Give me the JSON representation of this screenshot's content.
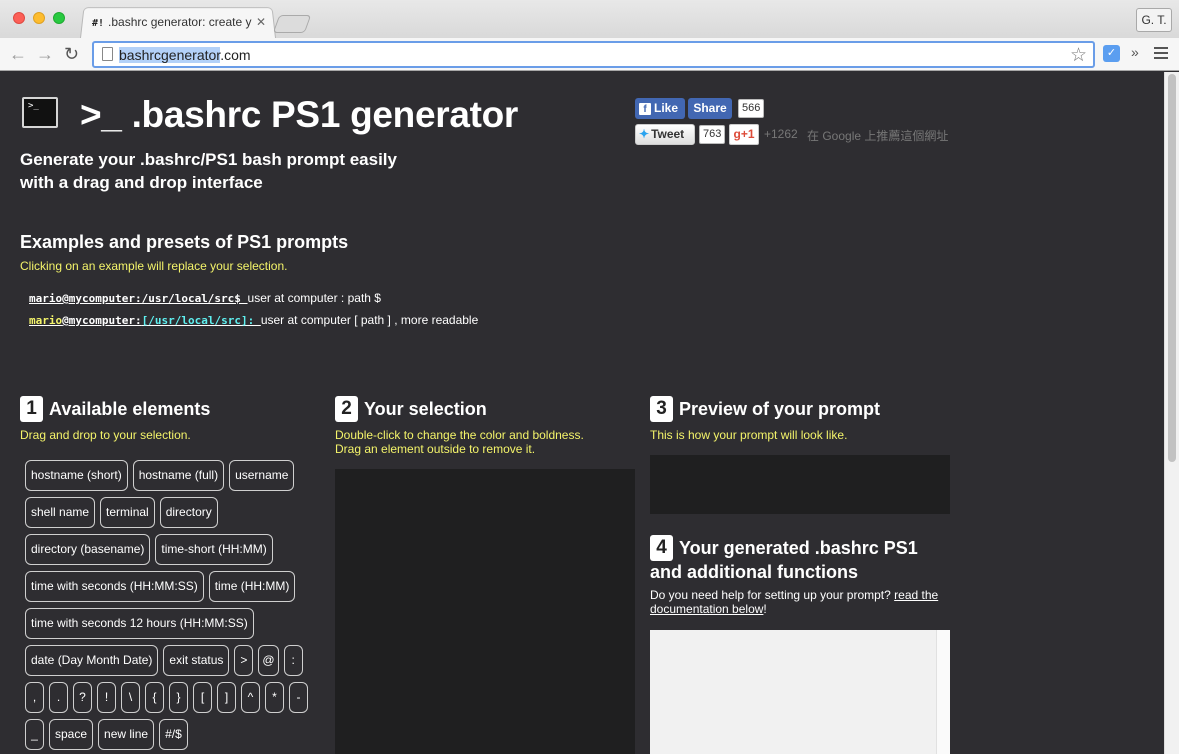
{
  "browser": {
    "tab_title": ".bashrc generator: create y",
    "tab_favicon": "#!",
    "tab_close": "✕",
    "user_button": "G. T.",
    "url_selected": "bashrcgenerator",
    "url_rest": ".com"
  },
  "header": {
    "icon_text": ">_",
    "title": ">_ .bashrc PS1 generator",
    "subtitle_line1": "Generate your .bashrc/PS1 bash prompt easily",
    "subtitle_line2": "with a drag and drop interface"
  },
  "social": {
    "fb_like": "Like",
    "fb_share": "Share",
    "fb_count": "566",
    "tweet": "Tweet",
    "tweet_count": "763",
    "gplus": "g+1",
    "gplus_count": "+1262",
    "gplus_text": "在 Google 上推薦這個網址"
  },
  "examples": {
    "title": "Examples and presets of PS1 prompts",
    "hint": "Clicking on an example will replace your selection.",
    "items": [
      {
        "code": "mario@mycomputer:/usr/local/src$ ",
        "desc": "user at computer : path $"
      },
      {
        "code_user": "mario",
        "code_host": "@mycomputer:",
        "code_path": "[/usr/local/src]: ",
        "desc": "user at computer [ path ] , more readable"
      }
    ]
  },
  "steps": {
    "s1": {
      "num": "1",
      "title": "Available elements",
      "hint": "Drag and drop to your selection."
    },
    "s2": {
      "num": "2",
      "title": "Your selection",
      "hint1": "Double-click to change the color and boldness.",
      "hint2": "Drag an element outside to remove it."
    },
    "s3": {
      "num": "3",
      "title": "Preview of your prompt",
      "hint": "This is how your prompt will look like."
    },
    "s4": {
      "num": "4",
      "title": "Your generated .bashrc PS1",
      "title2": "and additional functions",
      "hint": "Do you need help for setting up your prompt? ",
      "link": "read the documentation below",
      "after": "!"
    }
  },
  "elements": [
    "hostname (short)",
    "hostname (full)",
    "username",
    "shell name",
    "terminal",
    "directory",
    "directory (basename)",
    "time-short (HH:MM)",
    "time with seconds (HH:MM:SS)",
    "time (HH:MM)",
    "time with seconds 12 hours (HH:MM:SS)",
    "date (Day Month Date)",
    "exit status",
    ">",
    "@",
    ":",
    ",",
    ".",
    "?",
    "!",
    "\\",
    "{",
    "}",
    "[",
    "]",
    "^",
    "*",
    "-",
    "_",
    "space",
    "new line",
    "#/$"
  ]
}
